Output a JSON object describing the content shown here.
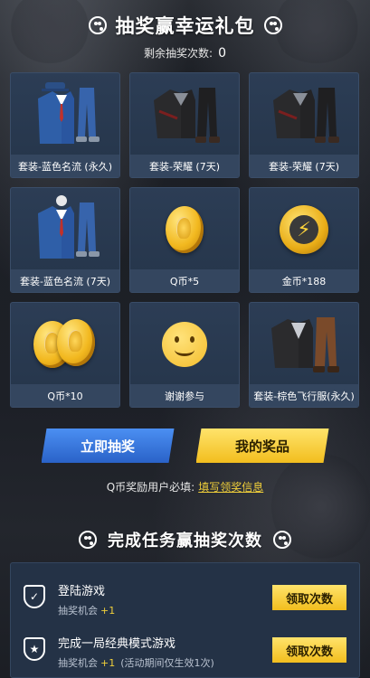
{
  "header": {
    "title": "抽奖赢幸运礼包"
  },
  "remaining": {
    "label": "剩余抽奖次数:",
    "count": "0"
  },
  "prizes": [
    {
      "label": "套装-蓝色名流 (永久)",
      "icon": "blue-suit-icon"
    },
    {
      "label": "套装-荣耀 (7天)",
      "icon": "black-jacket-outfit-icon"
    },
    {
      "label": "套装-荣耀 (7天)",
      "icon": "black-jacket-outfit-icon"
    },
    {
      "label": "套装-蓝色名流 (7天)",
      "icon": "blue-suit-icon"
    },
    {
      "label": "Q币*5",
      "icon": "q-coin-icon"
    },
    {
      "label": "金币*188",
      "icon": "gold-coin-icon"
    },
    {
      "label": "Q币*10",
      "icon": "q-coins-stack-icon"
    },
    {
      "label": "谢谢参与",
      "icon": "smiley-icon"
    },
    {
      "label": "套装-棕色飞行服(永久)",
      "icon": "brown-flight-suit-icon"
    }
  ],
  "actions": {
    "draw_label": "立即抽奖",
    "my_prizes_label": "我的奖品"
  },
  "notice": {
    "text": "Q币奖励用户必填:",
    "link": "填写领奖信息"
  },
  "tasks_section": {
    "title": "完成任务赢抽奖次数",
    "tasks": [
      {
        "name": "登陆游戏",
        "reward_label": "抽奖机会",
        "reward_value": "+1",
        "note": "",
        "button": "领取次数"
      },
      {
        "name": "完成一局经典模式游戏",
        "reward_label": "抽奖机会",
        "reward_value": "+1",
        "note": "(活动期间仅生效1次)",
        "button": "领取次数"
      }
    ]
  },
  "colors": {
    "accent_yellow": "#f2be1e",
    "accent_blue": "#2a62c8",
    "panel": "#2c3d55"
  }
}
